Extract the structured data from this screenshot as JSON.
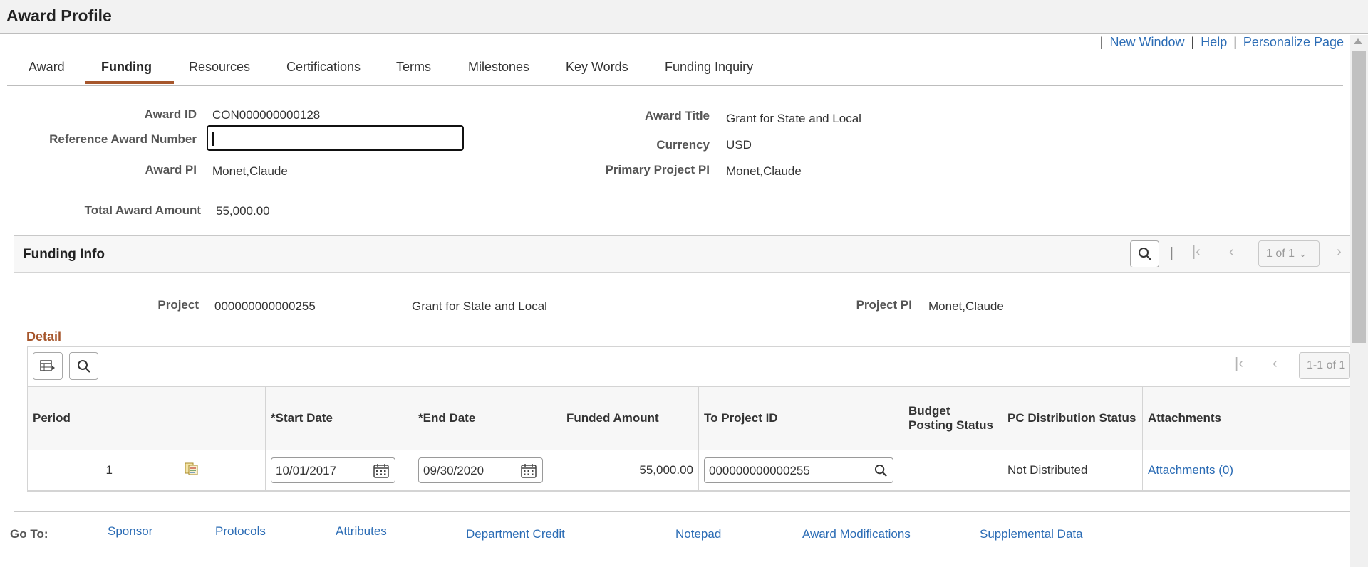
{
  "page_title": "Award Profile",
  "top_links": [
    "New Window",
    "Help",
    "Personalize Page"
  ],
  "tabs": [
    {
      "label": "Award",
      "active": false
    },
    {
      "label": "Funding",
      "active": true
    },
    {
      "label": "Resources",
      "active": false
    },
    {
      "label": "Certifications",
      "active": false
    },
    {
      "label": "Terms",
      "active": false
    },
    {
      "label": "Milestones",
      "active": false
    },
    {
      "label": "Key Words",
      "active": false
    },
    {
      "label": "Funding Inquiry",
      "active": false
    }
  ],
  "header": {
    "award_id_label": "Award ID",
    "award_id": "CON000000000128",
    "reference_award_number_label": "Reference Award Number",
    "reference_award_number": "",
    "award_pi_label": "Award PI",
    "award_pi": "Monet,Claude",
    "award_title_label": "Award Title",
    "award_title": "Grant for State and Local",
    "currency_label": "Currency",
    "currency": "USD",
    "primary_project_pi_label": "Primary Project PI",
    "primary_project_pi": "Monet,Claude",
    "total_award_amount_label": "Total Award Amount",
    "total_award_amount": "55,000.00"
  },
  "funding_info": {
    "title": "Funding Info",
    "pager": "1 of 1",
    "project_label": "Project",
    "project_id": "000000000000255",
    "project_desc": "Grant for State and Local",
    "project_pi_label": "Project PI",
    "project_pi": "Monet,Claude",
    "detail": {
      "title": "Detail",
      "pager": "1-1 of 1",
      "columns": [
        "Period",
        "",
        "*Start Date",
        "*End Date",
        "Funded Amount",
        "To Project ID",
        "Budget Posting Status",
        "PC Distribution Status",
        "Attachments"
      ],
      "rows": [
        {
          "period": "1",
          "start_date": "10/01/2017",
          "end_date": "09/30/2020",
          "funded_amount": "55,000.00",
          "to_project_id": "000000000000255",
          "budget_posting_status": "",
          "pc_distribution_status": "Not Distributed",
          "attachments": "Attachments (0)"
        }
      ]
    }
  },
  "go_to": {
    "label": "Go To:",
    "links": [
      "Sponsor",
      "Protocols",
      "Attributes",
      "Department Credit",
      "Notepad",
      "Award Modifications",
      "Supplemental Data"
    ]
  }
}
